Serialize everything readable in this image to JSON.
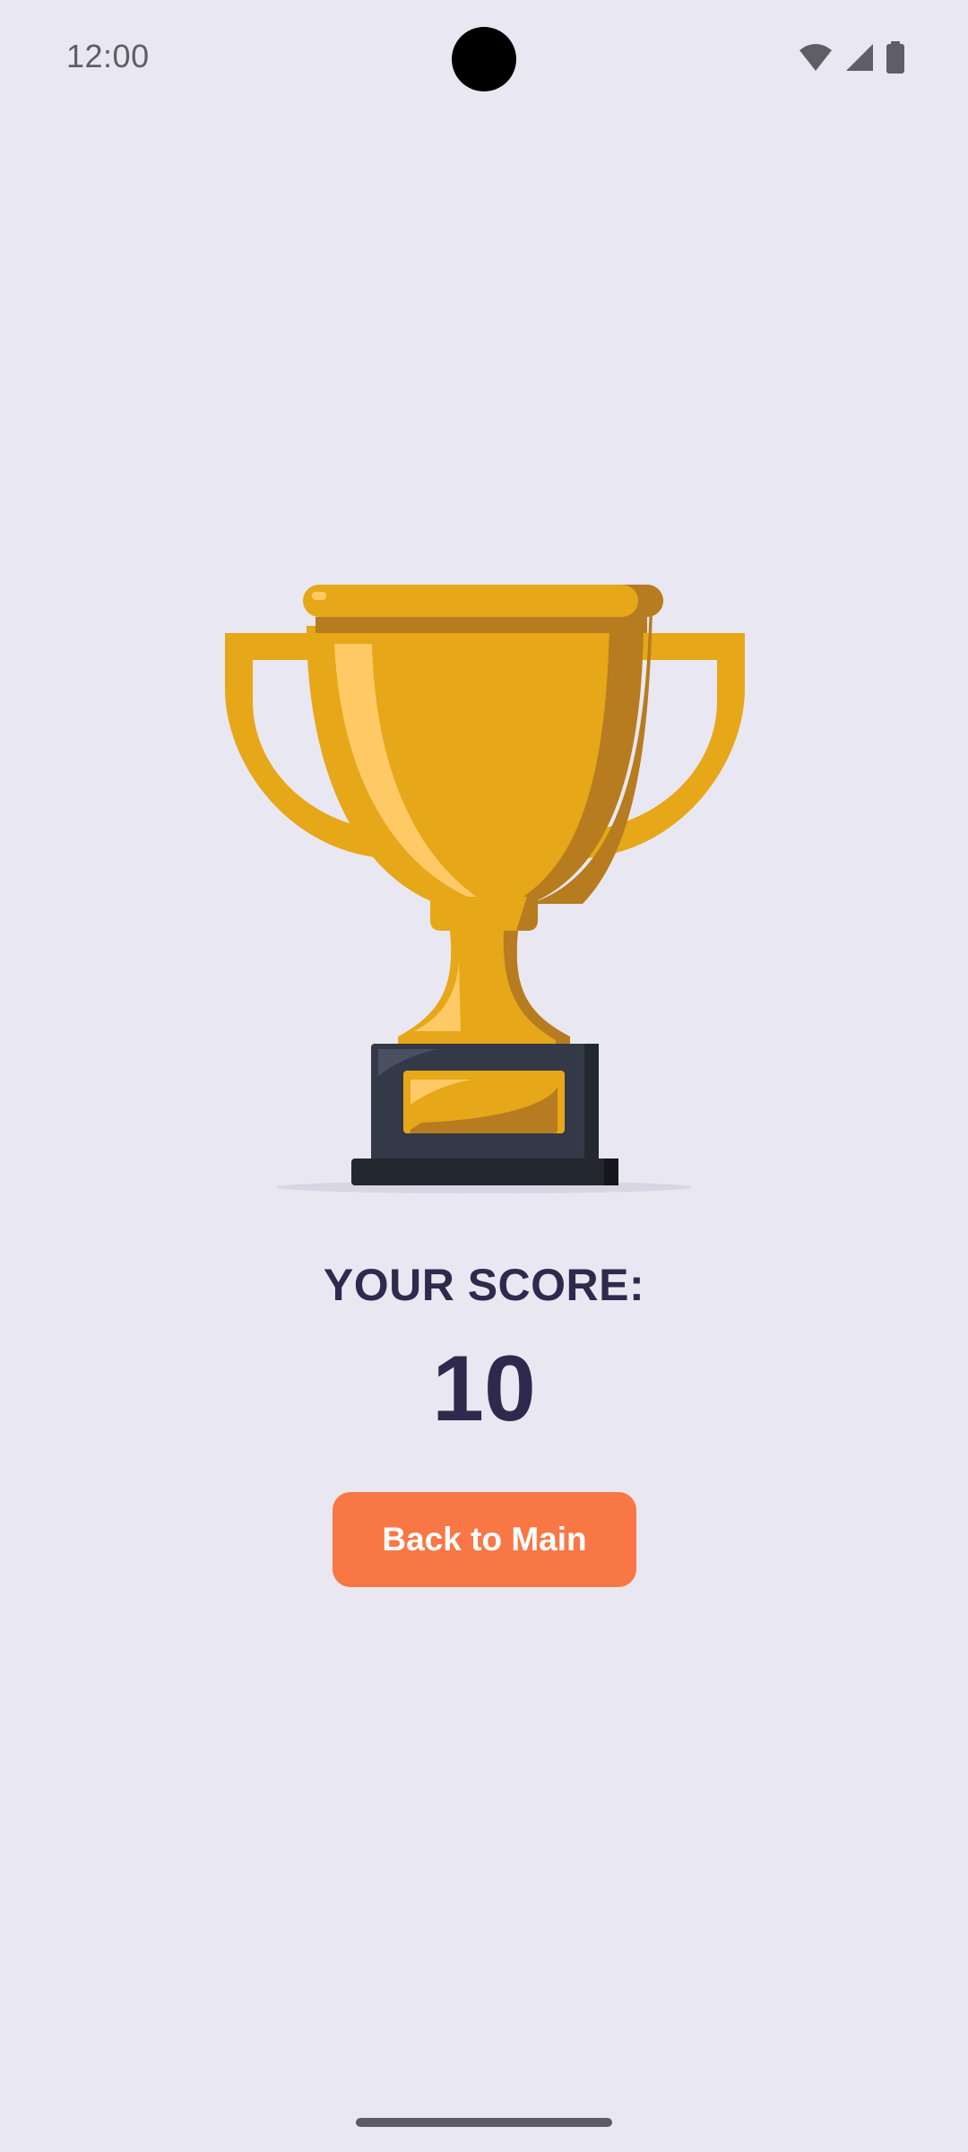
{
  "status_bar": {
    "time": "12:00",
    "icons": [
      "wifi-icon",
      "cellular-signal-icon",
      "battery-icon"
    ]
  },
  "trophy": {
    "icon": "trophy-icon",
    "colors": {
      "gold": "#e6a718",
      "gold_shadow": "#b67c1f",
      "gold_highlight": "#ffc966",
      "base": "#333946",
      "base_dark": "#23272f"
    }
  },
  "score": {
    "label": "YOUR SCORE:",
    "value": "10"
  },
  "actions": {
    "back_label": "Back to Main"
  },
  "theme": {
    "background": "#e9e7f1",
    "text": "#2f2a4d",
    "accent": "#f97745"
  }
}
